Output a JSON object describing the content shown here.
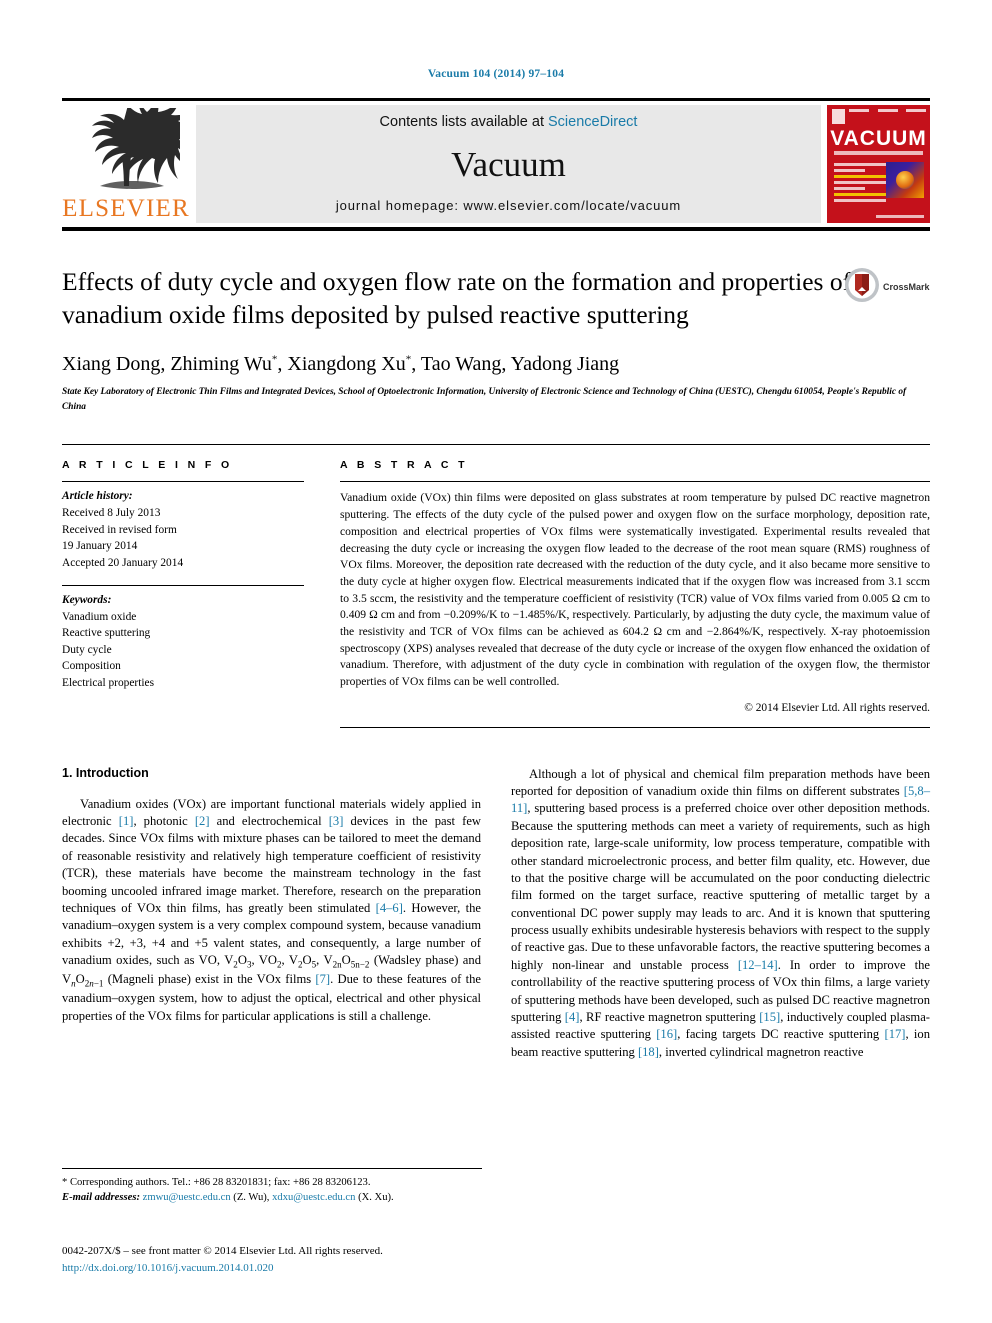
{
  "running_head": "Vacuum 104 (2014) 97–104",
  "masthead": {
    "publisher_logo_text": "ELSEVIER",
    "contents_prefix": "Contents lists available at ",
    "contents_link": "ScienceDirect",
    "journal_name": "Vacuum",
    "homepage": "journal homepage: www.elsevier.com/locate/vacuum",
    "cover_title": "VACUUM"
  },
  "title": "Effects of duty cycle and oxygen flow rate on the formation and properties of vanadium oxide films deposited by pulsed reactive sputtering",
  "crossmark_label": "CrossMark",
  "authors_html": "Xiang Dong, Zhiming Wu<sup>*</sup>, Xiangdong Xu<sup>*</sup>, Tao Wang, Yadong Jiang",
  "affiliation": "State Key Laboratory of Electronic Thin Films and Integrated Devices, School of Optoelectronic Information, University of Electronic Science and Technology of China (UESTC), Chengdu 610054, People's Republic of China",
  "article_info": {
    "heading": "A R T I C L E   I N F O",
    "history_label": "Article history:",
    "history": [
      "Received 8 July 2013",
      "Received in revised form",
      "19 January 2014",
      "Accepted 20 January 2014"
    ],
    "keywords_label": "Keywords:",
    "keywords": [
      "Vanadium oxide",
      "Reactive sputtering",
      "Duty cycle",
      "Composition",
      "Electrical properties"
    ]
  },
  "abstract": {
    "heading": "A B S T R A C T",
    "text": "Vanadium oxide (VOx) thin films were deposited on glass substrates at room temperature by pulsed DC reactive magnetron sputtering. The effects of the duty cycle of the pulsed power and oxygen flow on the surface morphology, deposition rate, composition and electrical properties of VOx films were systematically investigated. Experimental results revealed that decreasing the duty cycle or increasing the oxygen flow leaded to the decrease of the root mean square (RMS) roughness of VOx films. Moreover, the deposition rate decreased with the reduction of the duty cycle, and it also became more sensitive to the duty cycle at higher oxygen flow. Electrical measurements indicated that if the oxygen flow was increased from 3.1 sccm to 3.5 sccm, the resistivity and the temperature coefficient of resistivity (TCR) value of VOx films varied from 0.005 Ω cm to 0.409 Ω cm and from −0.209%/K to −1.485%/K, respectively. Particularly, by adjusting the duty cycle, the maximum value of the resistivity and TCR of VOx films can be achieved as 604.2 Ω cm and −2.864%/K, respectively. X-ray photoemission spectroscopy (XPS) analyses revealed that decrease of the duty cycle or increase of the oxygen flow enhanced the oxidation of vanadium. Therefore, with adjustment of the duty cycle in combination with regulation of the oxygen flow, the thermistor properties of VOx films can be well controlled.",
    "copyright": "© 2014 Elsevier Ltd. All rights reserved."
  },
  "introduction": {
    "heading": "1. Introduction",
    "left_paragraph_html": "Vanadium oxides (VOx) are important functional materials widely applied in electronic <span class=\"ref\">[1]</span>, photonic <span class=\"ref\">[2]</span> and electrochemical <span class=\"ref\">[3]</span> devices in the past few decades. Since VOx films with mixture phases can be tailored to meet the demand of reasonable resistivity and relatively high temperature coefficient of resistivity (TCR), these materials have become the mainstream technology in the fast booming uncooled infrared image market. Therefore, research on the preparation techniques of VOx thin films, has greatly been stimulated <span class=\"ref\">[4–6]</span>. However, the vanadium–oxygen system is a very complex compound system, because vanadium exhibits +2, +3, +4 and +5 valent states, and consequently, a large number of vanadium oxides, such as VO, V<sub>2</sub>O<sub>3</sub>, VO<sub>2</sub>, V<sub>2</sub>O<sub>5</sub>, V<sub>2n</sub>O<sub>5n−2</sub> (Wadsley phase) and V<sub><span class=\"ital\">n</span></sub>O<sub>2<span class=\"ital\">n</span>−1</sub> (Magneli phase) exist in the VOx films <span class=\"ref\">[7]</span>. Due to these features of the vanadium–oxygen system, how to adjust the optical, electrical and other physical properties of the VOx films for particular applications is still a challenge.",
    "right_paragraph_html": "Although a lot of physical and chemical film preparation methods have been reported for deposition of vanadium oxide thin films on different substrates <span class=\"ref\">[5,8–11]</span>, sputtering based process is a preferred choice over other deposition methods. Because the sputtering methods can meet a variety of requirements, such as high deposition rate, large-scale uniformity, low process temperature, compatible with other standard microelectronic process, and better film quality, etc. However, due to that the positive charge will be accumulated on the poor conducting dielectric film formed on the target surface, reactive sputtering of metallic target by a conventional DC power supply may leads to arc. And it is known that sputtering process usually exhibits undesirable hysteresis behaviors with respect to the supply of reactive gas. Due to these unfavorable factors, the reactive sputtering becomes a highly non-linear and unstable process <span class=\"ref\">[12–14]</span>. In order to improve the controllability of the reactive sputtering process of VOx thin films, a large variety of sputtering methods have been developed, such as pulsed DC reactive magnetron sputtering <span class=\"ref\">[4]</span>, RF reactive magnetron sputtering <span class=\"ref\">[15]</span>, inductively coupled plasma-assisted reactive sputtering <span class=\"ref\">[16]</span>, facing targets DC reactive sputtering <span class=\"ref\">[17]</span>, ion beam reactive sputtering <span class=\"ref\">[18]</span>, inverted cylindrical magnetron reactive"
  },
  "footnotes": {
    "corresponding_html": "* Corresponding authors. Tel.: +86 28 83201831; fax: +86 28 83206123.",
    "email_html": "<span class=\"ital\">E-mail addresses:</span> <span class=\"link\">zmwu@uestc.edu.cn</span> (Z. Wu), <span class=\"link\">xdxu@uestc.edu.cn</span> (X. Xu)."
  },
  "footer": {
    "issn_line": "0042-207X/$ – see front matter © 2014 Elsevier Ltd. All rights reserved.",
    "doi": "http://dx.doi.org/10.1016/j.vacuum.2014.01.020"
  },
  "colors": {
    "link": "#1a7ba8",
    "elsevier_orange": "#E87722",
    "cover_red": "#c4111b"
  }
}
